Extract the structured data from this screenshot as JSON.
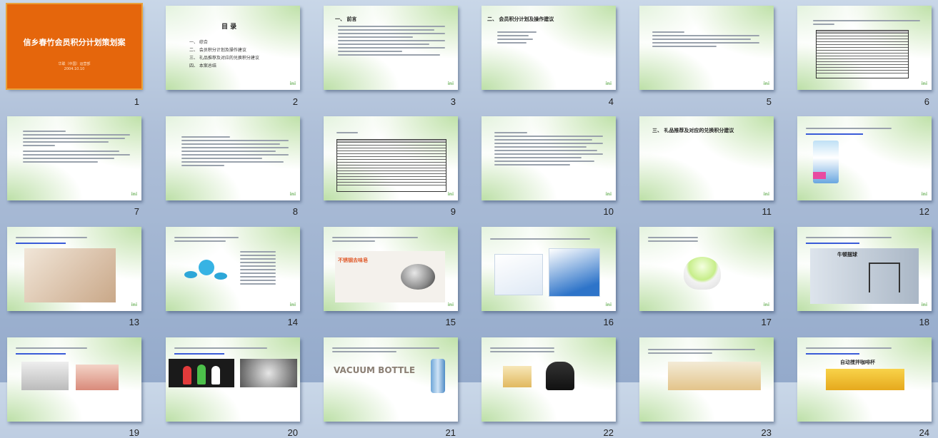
{
  "slides": [
    {
      "num": "1",
      "title": "信乡春竹会员积分计划策划案",
      "subtitle": "华联（中国）运营部",
      "date": "2004.10.10"
    },
    {
      "num": "2",
      "heading": "目  录",
      "items": [
        "一、 综合",
        "二、 会员积分计划及操作建议",
        "三、 礼品推荐及对应的兑换积分建议",
        "四、 本案总结"
      ]
    },
    {
      "num": "3",
      "heading": "一、 前言"
    },
    {
      "num": "4",
      "heading": "二、 会员积分计划及操作建议"
    },
    {
      "num": "5"
    },
    {
      "num": "6"
    },
    {
      "num": "7"
    },
    {
      "num": "8"
    },
    {
      "num": "9"
    },
    {
      "num": "10"
    },
    {
      "num": "11",
      "heading": "三、 礼品推荐及对应的兑换积分建议"
    },
    {
      "num": "12"
    },
    {
      "num": "13"
    },
    {
      "num": "14"
    },
    {
      "num": "15",
      "caption": "不锈钢去味皂"
    },
    {
      "num": "16"
    },
    {
      "num": "17"
    },
    {
      "num": "18",
      "caption": "牛顿摆球"
    },
    {
      "num": "19"
    },
    {
      "num": "20"
    },
    {
      "num": "21",
      "caption": "VACUUM BOTTLE"
    },
    {
      "num": "22"
    },
    {
      "num": "23"
    },
    {
      "num": "24",
      "caption": "自动搅拌咖啡杯"
    }
  ]
}
